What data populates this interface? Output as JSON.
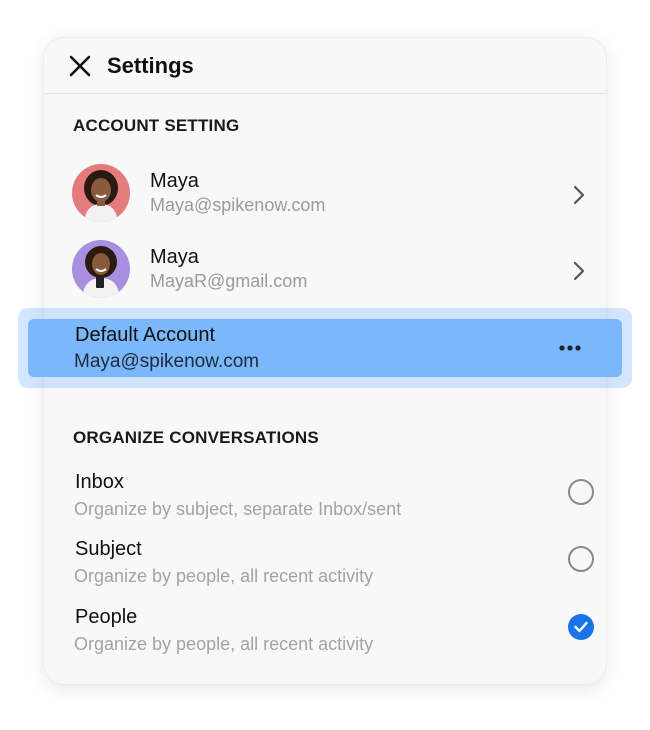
{
  "header": {
    "title": "Settings"
  },
  "account_section": {
    "title": "ACCOUNT SETTING",
    "accounts": [
      {
        "name": "Maya",
        "email": "Maya@spikenow.com",
        "avatar_bg": "#e57c7c"
      },
      {
        "name": "Maya",
        "email": "MayaR@gmail.com",
        "avatar_bg": "#a98fe0"
      }
    ],
    "default_account": {
      "label": "Default Account",
      "email": "Maya@spikenow.com"
    }
  },
  "organize_section": {
    "title": "ORGANIZE CONVERSATIONS",
    "options": [
      {
        "title": "Inbox",
        "description": "Organize by subject, separate Inbox/sent",
        "selected": false
      },
      {
        "title": "Subject",
        "description": "Organize by people, all recent activity",
        "selected": false
      },
      {
        "title": "People",
        "description": "Organize by people, all recent activity",
        "selected": true
      }
    ]
  },
  "colors": {
    "accent": "#1a73e8",
    "highlight": "#7ab7fb",
    "panel": "#f8f8f8"
  }
}
